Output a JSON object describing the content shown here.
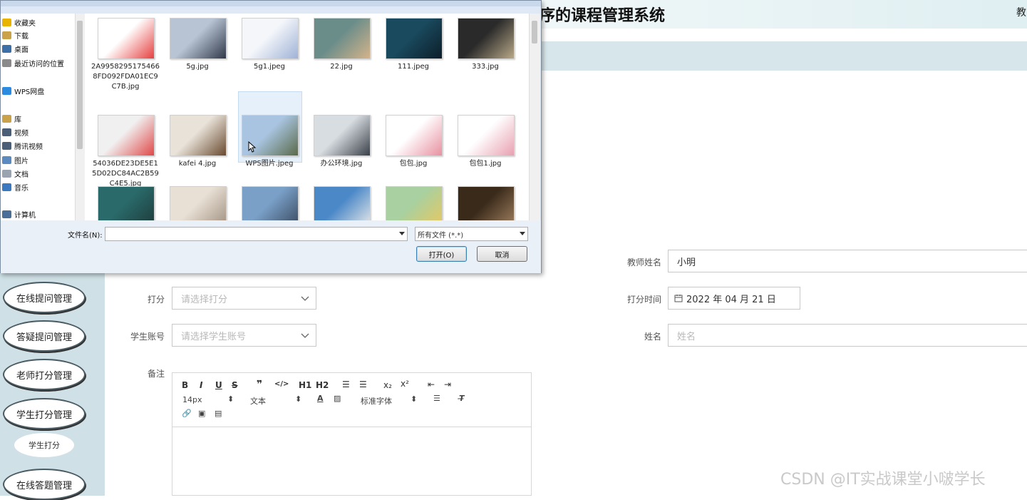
{
  "app": {
    "title": "序的课程管理系统",
    "user_text": "教"
  },
  "sidebar": {
    "items": [
      "在线提问管理",
      "答疑提问管理",
      "老师打分管理",
      "学生打分管理",
      "在线答题管理"
    ],
    "sub_item": "学生打分"
  },
  "form": {
    "teacher_name_label": "教师姓名",
    "teacher_name_value": "小明",
    "score_label": "打分",
    "score_placeholder": "请选择打分",
    "score_time_label": "打分时间",
    "score_time_value": "2022 年 04 月 21 日",
    "student_account_label": "学生账号",
    "student_account_placeholder": "请选择学生账号",
    "name_label": "姓名",
    "name_placeholder": "姓名",
    "remarks_label": "备注"
  },
  "editor": {
    "font_size": "14px",
    "text_style": "文本",
    "font_family": "标准字体",
    "h1": "H1",
    "h2": "H2"
  },
  "watermark": "CSDN @IT实战课堂小啵学长",
  "dialog": {
    "tree": [
      {
        "label": "收藏夹",
        "icon": "star-icon",
        "color": "#e8b400"
      },
      {
        "label": "下载",
        "icon": "download-folder-icon",
        "color": "#c9a24a"
      },
      {
        "label": "桌面",
        "icon": "desktop-icon",
        "color": "#3c6ea8"
      },
      {
        "label": "最近访问的位置",
        "icon": "recent-icon",
        "color": "#8a8a8a"
      },
      {
        "label": "WPS网盘",
        "icon": "cloud-icon",
        "color": "#2b8be0"
      },
      {
        "label": "库",
        "icon": "library-icon",
        "color": "#c9a24a"
      },
      {
        "label": "视频",
        "icon": "video-icon",
        "color": "#4a5e78"
      },
      {
        "label": "腾讯视频",
        "icon": "video-icon",
        "color": "#4a5e78"
      },
      {
        "label": "图片",
        "icon": "pictures-icon",
        "color": "#5a8ac0"
      },
      {
        "label": "文档",
        "icon": "documents-icon",
        "color": "#9aa3b0"
      },
      {
        "label": "音乐",
        "icon": "music-icon",
        "color": "#3a78c0"
      },
      {
        "label": "计算机",
        "icon": "computer-icon",
        "color": "#4a6e98"
      }
    ],
    "files": [
      {
        "name": "2A99582951754668FD092FDA01EC9C7B.jpg",
        "c1": "#ffffff",
        "c2": "#e64040"
      },
      {
        "name": "5g.jpg",
        "c1": "#b8c4d4",
        "c2": "#30394a"
      },
      {
        "name": "5g1.jpeg",
        "c1": "#f4f6fa",
        "c2": "#9fb2d6"
      },
      {
        "name": "22.jpg",
        "c1": "#6a8d8a",
        "c2": "#d4b38a"
      },
      {
        "name": "111.jpeg",
        "c1": "#1a4a5e",
        "c2": "#0c1e2a"
      },
      {
        "name": "333.jpg",
        "c1": "#2a2a2a",
        "c2": "#b8a888"
      },
      {
        "name": "54036DE23DE5E15D02DC84AC2B59C4E5.jpg",
        "c1": "#f0f0f0",
        "c2": "#e04848"
      },
      {
        "name": "kafei 4.jpg",
        "c1": "#e8e2d8",
        "c2": "#6a4a30"
      },
      {
        "name": "WPS图片.jpeg",
        "c1": "#a8c4e0",
        "c2": "#5a6a4a"
      },
      {
        "name": "办公环境.jpg",
        "c1": "#d8dde2",
        "c2": "#3a4048"
      },
      {
        "name": "包包.jpg",
        "c1": "#ffffff",
        "c2": "#e890a0"
      },
      {
        "name": "包包1.jpg",
        "c1": "#ffffff",
        "c2": "#e8a0b0"
      },
      {
        "name": "",
        "c1": "#2a6a6a",
        "c2": "#1e3a3a"
      },
      {
        "name": "",
        "c1": "#e8e0d4",
        "c2": "#a09080"
      },
      {
        "name": "",
        "c1": "#7aa0c8",
        "c2": "#3a4a60"
      },
      {
        "name": "",
        "c1": "#4a88c8",
        "c2": "#e8e8e8"
      },
      {
        "name": "",
        "c1": "#a8d0a0",
        "c2": "#e8c860"
      },
      {
        "name": "",
        "c1": "#3a2a1a",
        "c2": "#a08060"
      }
    ],
    "filename_label": "文件名(N):",
    "filename_value": "",
    "file_type": "所有文件 (*.*)",
    "open_button": "打开(O)",
    "cancel_button": "取消"
  }
}
